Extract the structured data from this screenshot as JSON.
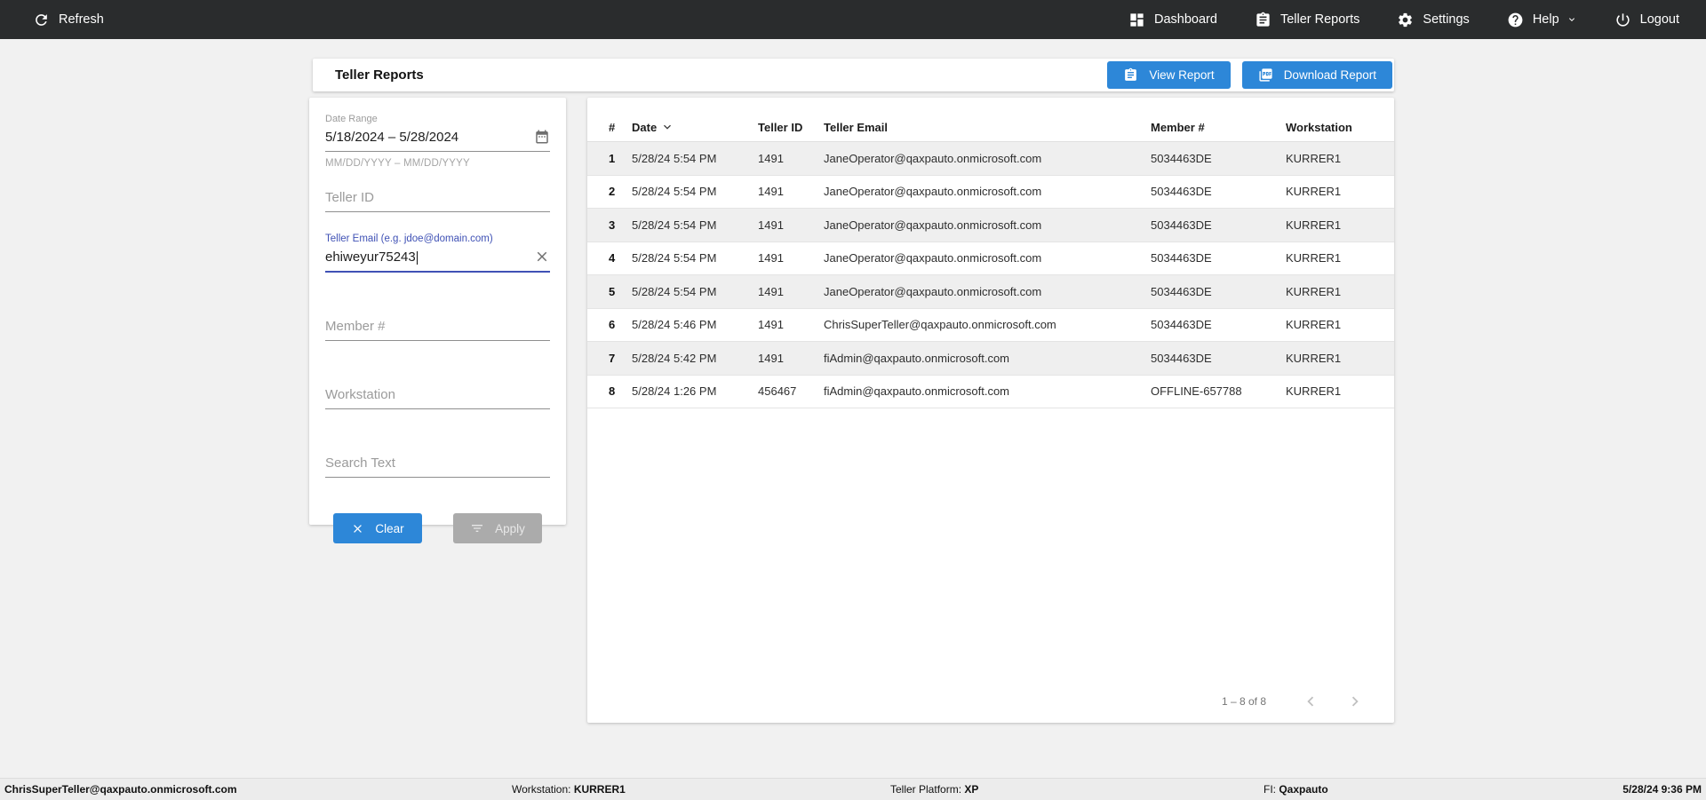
{
  "topbar": {
    "refresh_label": "Refresh",
    "items": [
      {
        "label": "Dashboard",
        "icon": "dashboard-icon"
      },
      {
        "label": "Teller Reports",
        "icon": "clipboard-icon"
      },
      {
        "label": "Settings",
        "icon": "gear-icon"
      },
      {
        "label": "Help",
        "icon": "help-icon"
      },
      {
        "label": "Logout",
        "icon": "power-icon"
      }
    ]
  },
  "header": {
    "title": "Teller Reports",
    "view_report_label": "View Report",
    "download_report_label": "Download Report"
  },
  "filters": {
    "date_range": {
      "label": "Date Range",
      "value": "5/18/2024 – 5/28/2024",
      "hint": "MM/DD/YYYY – MM/DD/YYYY"
    },
    "teller_id": {
      "placeholder": "Teller ID",
      "value": ""
    },
    "teller_email": {
      "label": "Teller Email (e.g. jdoe@domain.com)",
      "value": "ehiweyur75243"
    },
    "member_number": {
      "placeholder": "Member #",
      "value": ""
    },
    "workstation": {
      "placeholder": "Workstation",
      "value": ""
    },
    "search_text": {
      "placeholder": "Search Text",
      "value": ""
    },
    "clear_label": "Clear",
    "apply_label": "Apply"
  },
  "table": {
    "columns": [
      "#",
      "Date",
      "Teller ID",
      "Teller Email",
      "Member #",
      "Workstation"
    ],
    "sorted_by": "Date",
    "sort_direction": "desc",
    "rows": [
      [
        "1",
        "5/28/24 5:54 PM",
        "1491",
        "JaneOperator@qaxpauto.onmicrosoft.com",
        "5034463DE",
        "KURRER1"
      ],
      [
        "2",
        "5/28/24 5:54 PM",
        "1491",
        "JaneOperator@qaxpauto.onmicrosoft.com",
        "5034463DE",
        "KURRER1"
      ],
      [
        "3",
        "5/28/24 5:54 PM",
        "1491",
        "JaneOperator@qaxpauto.onmicrosoft.com",
        "5034463DE",
        "KURRER1"
      ],
      [
        "4",
        "5/28/24 5:54 PM",
        "1491",
        "JaneOperator@qaxpauto.onmicrosoft.com",
        "5034463DE",
        "KURRER1"
      ],
      [
        "5",
        "5/28/24 5:54 PM",
        "1491",
        "JaneOperator@qaxpauto.onmicrosoft.com",
        "5034463DE",
        "KURRER1"
      ],
      [
        "6",
        "5/28/24 5:46 PM",
        "1491",
        "ChrisSuperTeller@qaxpauto.onmicrosoft.com",
        "5034463DE",
        "KURRER1"
      ],
      [
        "7",
        "5/28/24 5:42 PM",
        "1491",
        "fiAdmin@qaxpauto.onmicrosoft.com",
        "5034463DE",
        "KURRER1"
      ],
      [
        "8",
        "5/28/24 1:26 PM",
        "456467",
        "fiAdmin@qaxpauto.onmicrosoft.com",
        "OFFLINE-657788",
        "KURRER1"
      ]
    ],
    "pagination": {
      "range_label": "1 – 8 of 8"
    }
  },
  "footer": {
    "user_email": "ChrisSuperTeller@qaxpauto.onmicrosoft.com",
    "workstation_label": "Workstation:",
    "workstation_value": "KURRER1",
    "platform_label": "Teller Platform:",
    "platform_value": "XP",
    "fi_label": "FI:",
    "fi_value": "Qaxpauto",
    "datetime": "5/28/24 9:36 PM"
  },
  "colors": {
    "accent_blue": "#2d87d8",
    "topbar_bg": "#2a2c2d",
    "focus_indigo": "#3f51b5",
    "stripe_gray": "#efefef"
  }
}
